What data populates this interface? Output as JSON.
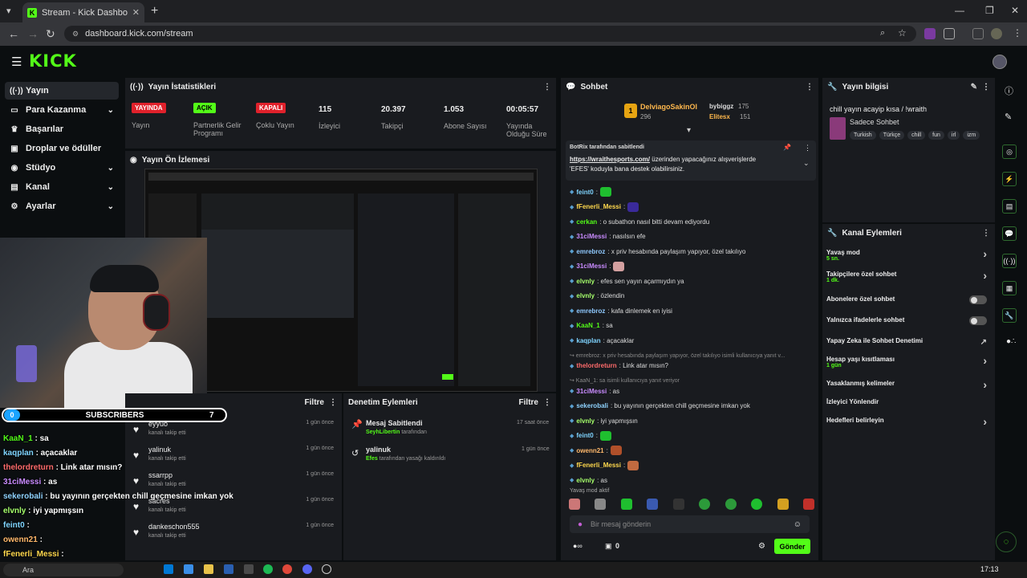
{
  "browser": {
    "tab_title": "Stream - Kick Dashboard",
    "url": "dashboard.kick.com/stream",
    "new_tab": "+",
    "close": "✕"
  },
  "sidebar": {
    "items": [
      {
        "label": "Yayın",
        "icon": "broadcast-icon"
      },
      {
        "label": "Para Kazanma",
        "icon": "money-icon"
      },
      {
        "label": "Başarılar",
        "icon": "trophy-icon"
      },
      {
        "label": "Droplar ve ödüller",
        "icon": "gift-icon"
      },
      {
        "label": "Stüdyo",
        "icon": "studio-icon"
      },
      {
        "label": "Kanal",
        "icon": "channel-icon"
      },
      {
        "label": "Ayarlar",
        "icon": "gear-icon"
      }
    ]
  },
  "logo": "KICK",
  "stats": {
    "title": "Yayın İstatistikleri",
    "items": [
      {
        "badge": "YAYINDA",
        "label": "Yayın"
      },
      {
        "badge": "AÇIK",
        "label": "Partnerlik Gelir Programı"
      },
      {
        "badge": "KAPALI",
        "label": "Çoklu Yayın"
      },
      {
        "value": "115",
        "label": "İzleyici"
      },
      {
        "value": "20.397",
        "label": "Takipçi"
      },
      {
        "value": "1.053",
        "label": "Abone Sayısı"
      },
      {
        "value": "00:05:57",
        "label": "Yayında Olduğu Süre"
      }
    ]
  },
  "preview_title": "Yayın Ön İzlemesi",
  "subs": {
    "left": "0",
    "label": "SUBSCRIBERS",
    "right": "7"
  },
  "overlay_chat": [
    {
      "user": "KaaN_1",
      "msg": ": sa",
      "color": "#53fc18"
    },
    {
      "user": "kaqplan",
      "msg": ": açacaklar",
      "color": "#7fd4ff"
    },
    {
      "user": "thelordreturn",
      "msg": ": Link atar mısın?",
      "color": "#ff6b6b"
    },
    {
      "user": "31ciMessi",
      "msg": ": as",
      "color": "#c98bff"
    },
    {
      "user": "sekerobali",
      "msg": ": bu yayının gerçekten chill geçmesine imkan yok",
      "color": "#8fd3ff"
    },
    {
      "user": "elvnly",
      "msg": ": iyi yapmışsın",
      "color": "#a6ff6b"
    },
    {
      "user": "feint0",
      "msg": ":",
      "color": "#7fd4ff"
    },
    {
      "user": "owenn21",
      "msg": ":",
      "color": "#ffb86b"
    },
    {
      "user": "fFenerli_Messi",
      "msg": ":",
      "color": "#ffd84d"
    }
  ],
  "activity": {
    "filter": "Filtre",
    "items": [
      {
        "name": "eyyuo",
        "sub": "kanalı takip etti",
        "time": "1 gün önce"
      },
      {
        "name": "yalinuk",
        "sub": "kanalı takip etti",
        "time": "1 gün önce"
      },
      {
        "name": "ssarrpp",
        "sub": "kanalı takip etti",
        "time": "1 gün önce"
      },
      {
        "name": "sacres",
        "sub": "kanalı takip etti",
        "time": "1 gün önce"
      },
      {
        "name": "dankeschon555",
        "sub": "kanalı takip etti",
        "time": "1 gün önce"
      }
    ]
  },
  "moderation": {
    "title": "Denetim Eylemleri",
    "filter": "Filtre",
    "items": [
      {
        "title": "Mesaj Sabitlendi",
        "user": "SeyhLibertin",
        "suffix": "tarafından",
        "time": "17 saat önce"
      },
      {
        "title": "yalinuk",
        "user": "Efes",
        "suffix": "tarafından yasağı kaldırıldı",
        "time": "1 gün önce"
      }
    ]
  },
  "chat": {
    "title": "Sohbet",
    "top": [
      {
        "name": "DelviagoSakinOl",
        "amount": "296"
      },
      {
        "name": "bybiggz",
        "amount": "175"
      },
      {
        "name": "Elitesx",
        "amount": "151"
      }
    ],
    "pinned_by": "BotRix tarafından sabitlendi",
    "pinned_link": "https://wraithesports.com/",
    "pinned_text1": "üzerinden yapacağınız alışverişlerde",
    "pinned_text2": "'EFES' koduyla bana destek olabilirsiniz.",
    "messages": [
      {
        "user": "feint0",
        "msg": ":",
        "color": "#7fd4ff",
        "emote": "#1fbf2f"
      },
      {
        "user": "fFenerli_Messi",
        "msg": ":",
        "color": "#ffd84d",
        "emote": "#3a2a9a"
      },
      {
        "user": "cerkan",
        "msg": ": o subathon nasıl bitti devam ediyordu",
        "color": "#53fc18"
      },
      {
        "user": "31ciMessi",
        "msg": ": nasılsın efe",
        "color": "#c98bff"
      },
      {
        "user": "emrebroz",
        "msg": ": x priv hesabında paylaşım yapıyor, özel takılıyo",
        "color": "#8fc9ff"
      },
      {
        "user": "31ciMessi",
        "msg": ":",
        "color": "#c98bff",
        "emote": "#d3a0a0"
      },
      {
        "user": "elvnly",
        "msg": ": efes sen yayın açarmıydın ya",
        "color": "#a6ff6b"
      },
      {
        "user": "elvnly",
        "msg": ": özlendin",
        "color": "#a6ff6b"
      },
      {
        "user": "emrebroz",
        "msg": ": kafa dinlemek en iyisi",
        "color": "#8fc9ff"
      },
      {
        "user": "KaaN_1",
        "msg": ": sa",
        "color": "#53fc18"
      },
      {
        "user": "kaqplan",
        "msg": ": açacaklar",
        "color": "#7fd4ff"
      },
      {
        "user": "",
        "msg": "↪ emrebroz: x priv hesabında paylaşım yapıyor, özel takılıyo isimli kullanıcıya yanıt v...",
        "color": "#888"
      },
      {
        "user": "thelordreturn",
        "msg": ": Link atar mısın?",
        "color": "#ff6b6b"
      },
      {
        "user": "",
        "msg": "↪ KaaN_1: sa isimli kullanıcıya yanıt veriyor",
        "color": "#888"
      },
      {
        "user": "31ciMessi",
        "msg": ": as",
        "color": "#c98bff"
      },
      {
        "user": "sekerobali",
        "msg": ": bu yayının gerçekten chill geçmesine imkan yok",
        "color": "#8fd3ff"
      },
      {
        "user": "elvnly",
        "msg": ": iyi yapmışsın",
        "color": "#a6ff6b"
      },
      {
        "user": "feint0",
        "msg": ":",
        "color": "#7fd4ff",
        "emote": "#1fbf2f"
      },
      {
        "user": "owenn21",
        "msg": ":",
        "color": "#ffb86b",
        "emote": "#b0502a"
      },
      {
        "user": "fFenerli_Messi",
        "msg": ":",
        "color": "#ffd84d",
        "emote": "#c06a40"
      },
      {
        "user": "elvnly",
        "msg": ": as",
        "color": "#a6ff6b"
      }
    ],
    "slow_mode": "Yavaş mod aktif",
    "placeholder": "Bir mesaj gönderin",
    "send": "Gönder",
    "count": "0"
  },
  "stream_info": {
    "title": "Yayın bilgisi",
    "stream_title": "chill yayın acayip kısa / !wraith",
    "category": "Sadece Sohbet",
    "tags": [
      "Turkish",
      "Türkçe",
      "chill",
      "fun",
      "irl",
      "izm"
    ]
  },
  "channel_actions": {
    "title": "Kanal Eylemleri",
    "items": [
      {
        "label": "Yavaş mod",
        "sub": "5 sn.",
        "ctrl": "chevron"
      },
      {
        "label": "Takipçilere özel sohbet",
        "sub": "1 dk.",
        "ctrl": "chevron"
      },
      {
        "label": "Abonelere özel sohbet",
        "sub": "",
        "ctrl": "toggle"
      },
      {
        "label": "Yalnızca ifadelerle sohbet",
        "sub": "",
        "ctrl": "toggle"
      },
      {
        "label": "Yapay Zeka ile Sohbet Denetimi",
        "sub": "",
        "ctrl": "external"
      },
      {
        "label": "Hesap yaşı kısıtlaması",
        "sub": "1 gün",
        "ctrl": "chevron"
      },
      {
        "label": "Yasaklanmış kelimeler",
        "sub": "",
        "ctrl": "chevron"
      },
      {
        "label": "İzleyici Yönlendir",
        "sub": "",
        "ctrl": "none"
      },
      {
        "label": "Hedefleri belirleyin",
        "sub": "",
        "ctrl": "chevron"
      }
    ]
  },
  "taskbar": {
    "time": "17:13",
    "search": "Ara"
  }
}
